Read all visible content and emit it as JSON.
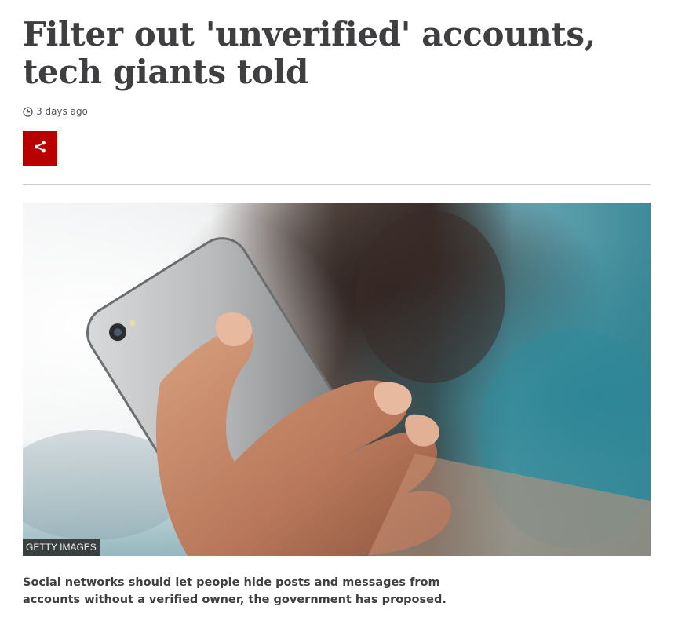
{
  "article": {
    "headline": "Filter out 'unverified' accounts, tech giants told",
    "timestamp": "3 days ago",
    "share_icon": "share-icon",
    "image_credit": "GETTY IMAGES",
    "standfirst": "Social networks should let people hide posts and messages from accounts without a verified owner, the government has proposed."
  },
  "colors": {
    "share_button_bg": "#b80000",
    "headline": "#3f3f42",
    "divider": "#c7c7c7"
  }
}
